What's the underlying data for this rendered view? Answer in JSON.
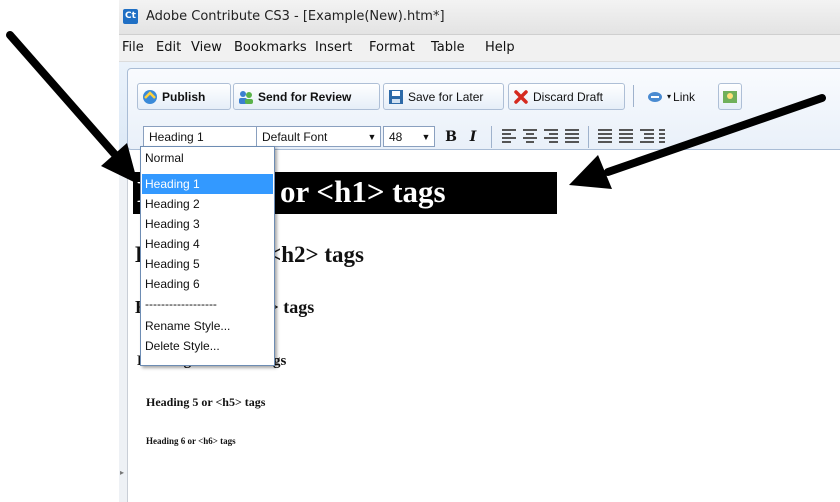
{
  "window": {
    "app_icon_text": "Ct",
    "title": "Adobe Contribute CS3 - [Example(New).htm*]"
  },
  "menu": [
    "File",
    "Edit",
    "View",
    "Bookmarks",
    "Insert",
    "Format",
    "Table",
    "Help"
  ],
  "toolbar": {
    "publish": "Publish",
    "send_for_review": "Send for Review",
    "save_for_later": "Save for Later",
    "discard_draft": "Discard Draft",
    "link": "Link"
  },
  "format_bar": {
    "style_value": "Heading 1",
    "font_value": "Default Font",
    "size_value": "48",
    "bold": "B",
    "italic": "I"
  },
  "style_dropdown": {
    "items": [
      "Normal",
      "Heading 1",
      "Heading 2",
      "Heading 3",
      "Heading 4",
      "Heading 5",
      "Heading 6",
      "------------------",
      "Rename Style...",
      "Delete Style..."
    ],
    "selected": "Heading 1"
  },
  "document": {
    "h1": "Heading 1 or <h1> tags",
    "h2": "Heading 2 or <h2> tags",
    "h3": "Heading 3 or <h3> tags",
    "h4": "Heading 4 or <h4> tags",
    "h5": "Heading 5 or <h5> tags",
    "h6": "Heading 6 or <h6> tags"
  },
  "colors": {
    "selection_highlight": "#3399ff",
    "selected_text_bg": "#000000",
    "annotation_arrow": "#000000"
  }
}
